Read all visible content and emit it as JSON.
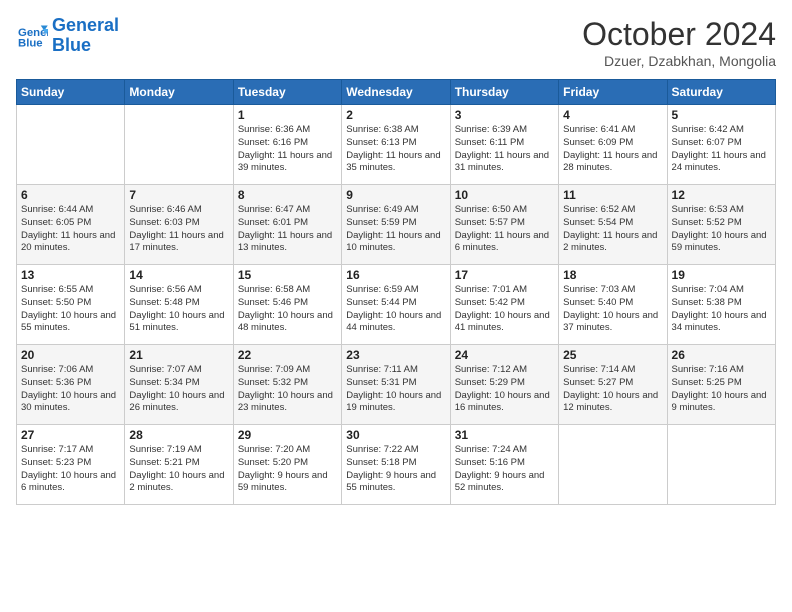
{
  "header": {
    "logo_line1": "General",
    "logo_line2": "Blue",
    "month": "October 2024",
    "location": "Dzuer, Dzabkhan, Mongolia"
  },
  "weekdays": [
    "Sunday",
    "Monday",
    "Tuesday",
    "Wednesday",
    "Thursday",
    "Friday",
    "Saturday"
  ],
  "weeks": [
    [
      {
        "day": "",
        "text": ""
      },
      {
        "day": "",
        "text": ""
      },
      {
        "day": "1",
        "text": "Sunrise: 6:36 AM\nSunset: 6:16 PM\nDaylight: 11 hours and 39 minutes."
      },
      {
        "day": "2",
        "text": "Sunrise: 6:38 AM\nSunset: 6:13 PM\nDaylight: 11 hours and 35 minutes."
      },
      {
        "day": "3",
        "text": "Sunrise: 6:39 AM\nSunset: 6:11 PM\nDaylight: 11 hours and 31 minutes."
      },
      {
        "day": "4",
        "text": "Sunrise: 6:41 AM\nSunset: 6:09 PM\nDaylight: 11 hours and 28 minutes."
      },
      {
        "day": "5",
        "text": "Sunrise: 6:42 AM\nSunset: 6:07 PM\nDaylight: 11 hours and 24 minutes."
      }
    ],
    [
      {
        "day": "6",
        "text": "Sunrise: 6:44 AM\nSunset: 6:05 PM\nDaylight: 11 hours and 20 minutes."
      },
      {
        "day": "7",
        "text": "Sunrise: 6:46 AM\nSunset: 6:03 PM\nDaylight: 11 hours and 17 minutes."
      },
      {
        "day": "8",
        "text": "Sunrise: 6:47 AM\nSunset: 6:01 PM\nDaylight: 11 hours and 13 minutes."
      },
      {
        "day": "9",
        "text": "Sunrise: 6:49 AM\nSunset: 5:59 PM\nDaylight: 11 hours and 10 minutes."
      },
      {
        "day": "10",
        "text": "Sunrise: 6:50 AM\nSunset: 5:57 PM\nDaylight: 11 hours and 6 minutes."
      },
      {
        "day": "11",
        "text": "Sunrise: 6:52 AM\nSunset: 5:54 PM\nDaylight: 11 hours and 2 minutes."
      },
      {
        "day": "12",
        "text": "Sunrise: 6:53 AM\nSunset: 5:52 PM\nDaylight: 10 hours and 59 minutes."
      }
    ],
    [
      {
        "day": "13",
        "text": "Sunrise: 6:55 AM\nSunset: 5:50 PM\nDaylight: 10 hours and 55 minutes."
      },
      {
        "day": "14",
        "text": "Sunrise: 6:56 AM\nSunset: 5:48 PM\nDaylight: 10 hours and 51 minutes."
      },
      {
        "day": "15",
        "text": "Sunrise: 6:58 AM\nSunset: 5:46 PM\nDaylight: 10 hours and 48 minutes."
      },
      {
        "day": "16",
        "text": "Sunrise: 6:59 AM\nSunset: 5:44 PM\nDaylight: 10 hours and 44 minutes."
      },
      {
        "day": "17",
        "text": "Sunrise: 7:01 AM\nSunset: 5:42 PM\nDaylight: 10 hours and 41 minutes."
      },
      {
        "day": "18",
        "text": "Sunrise: 7:03 AM\nSunset: 5:40 PM\nDaylight: 10 hours and 37 minutes."
      },
      {
        "day": "19",
        "text": "Sunrise: 7:04 AM\nSunset: 5:38 PM\nDaylight: 10 hours and 34 minutes."
      }
    ],
    [
      {
        "day": "20",
        "text": "Sunrise: 7:06 AM\nSunset: 5:36 PM\nDaylight: 10 hours and 30 minutes."
      },
      {
        "day": "21",
        "text": "Sunrise: 7:07 AM\nSunset: 5:34 PM\nDaylight: 10 hours and 26 minutes."
      },
      {
        "day": "22",
        "text": "Sunrise: 7:09 AM\nSunset: 5:32 PM\nDaylight: 10 hours and 23 minutes."
      },
      {
        "day": "23",
        "text": "Sunrise: 7:11 AM\nSunset: 5:31 PM\nDaylight: 10 hours and 19 minutes."
      },
      {
        "day": "24",
        "text": "Sunrise: 7:12 AM\nSunset: 5:29 PM\nDaylight: 10 hours and 16 minutes."
      },
      {
        "day": "25",
        "text": "Sunrise: 7:14 AM\nSunset: 5:27 PM\nDaylight: 10 hours and 12 minutes."
      },
      {
        "day": "26",
        "text": "Sunrise: 7:16 AM\nSunset: 5:25 PM\nDaylight: 10 hours and 9 minutes."
      }
    ],
    [
      {
        "day": "27",
        "text": "Sunrise: 7:17 AM\nSunset: 5:23 PM\nDaylight: 10 hours and 6 minutes."
      },
      {
        "day": "28",
        "text": "Sunrise: 7:19 AM\nSunset: 5:21 PM\nDaylight: 10 hours and 2 minutes."
      },
      {
        "day": "29",
        "text": "Sunrise: 7:20 AM\nSunset: 5:20 PM\nDaylight: 9 hours and 59 minutes."
      },
      {
        "day": "30",
        "text": "Sunrise: 7:22 AM\nSunset: 5:18 PM\nDaylight: 9 hours and 55 minutes."
      },
      {
        "day": "31",
        "text": "Sunrise: 7:24 AM\nSunset: 5:16 PM\nDaylight: 9 hours and 52 minutes."
      },
      {
        "day": "",
        "text": ""
      },
      {
        "day": "",
        "text": ""
      }
    ]
  ]
}
